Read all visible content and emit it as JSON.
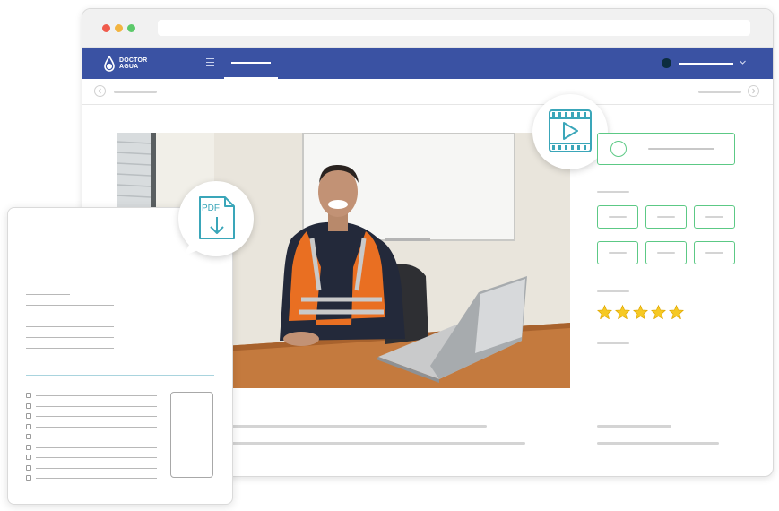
{
  "header": {
    "brand_line1": "DOCTOR",
    "brand_line2": "AGUA"
  },
  "icons": {
    "menu": "hamburger-menu-icon",
    "video": "video-play-icon",
    "pdf_download": "pdf-download-icon",
    "star": "star-icon",
    "chevron": "chevron-down-icon"
  },
  "pdf_badge": {
    "label": "PDF"
  },
  "rating": {
    "stars": 5,
    "max": 5
  },
  "colors": {
    "navbar": "#3a52a3",
    "accent_green": "#5cc985",
    "accent_teal": "#3aa6b9",
    "star": "#f6c924"
  }
}
